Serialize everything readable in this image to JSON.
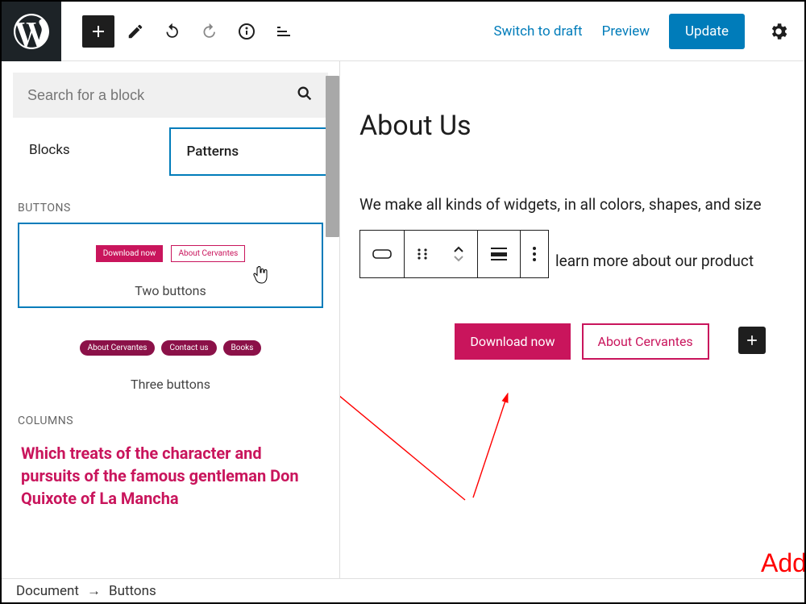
{
  "topbar": {
    "switch_draft": "Switch to draft",
    "preview": "Preview",
    "update": "Update"
  },
  "inserter": {
    "search_placeholder": "Search for a block",
    "tab_blocks": "Blocks",
    "tab_patterns": "Patterns",
    "section_buttons": "BUTTONS",
    "section_columns": "COLUMNS",
    "pattern1": {
      "caption": "Two buttons",
      "btn_a": "Download now",
      "btn_b": "About Cervantes"
    },
    "pattern2": {
      "caption": "Three buttons",
      "btn_a": "About Cervantes",
      "btn_b": "Contact us",
      "btn_c": "Books"
    },
    "columns_preview": "Which treats of the character and pursuits of the famous gentleman Don Quixote of La Mancha"
  },
  "canvas": {
    "title": "About Us",
    "para1": "We make all kinds of widgets, in all colors, shapes, and size",
    "para2": "learn more about our product",
    "inserted": {
      "btn_a": "Download now",
      "btn_b": "About Cervantes"
    }
  },
  "annotation": {
    "label": "Add Buttons"
  },
  "breadcrumb": {
    "root": "Document",
    "leaf": "Buttons"
  }
}
